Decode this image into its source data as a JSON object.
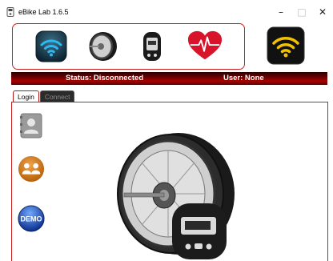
{
  "window": {
    "title": "eBike Lab 1.6.5",
    "controls": {
      "minimize": "–",
      "maximize": "□",
      "close": "✕"
    }
  },
  "toolbar": {
    "buttons": [
      {
        "name": "wifi",
        "icon": "wifi-icon"
      },
      {
        "name": "motor",
        "icon": "motor-icon"
      },
      {
        "name": "display",
        "icon": "display-icon"
      },
      {
        "name": "heart",
        "icon": "heart-rate-icon"
      }
    ],
    "connection_icon": "wifi-connection-icon"
  },
  "status": {
    "status_text": "Status: Disconnected",
    "user_text": "User: None",
    "bar_color": "#8b0000"
  },
  "tabs": [
    {
      "label": "Login",
      "active": true
    },
    {
      "label": "Connect",
      "active": false
    }
  ],
  "login_panel": {
    "side_buttons": [
      {
        "name": "contacts",
        "icon": "contact-book-icon"
      },
      {
        "name": "users",
        "icon": "users-group-icon"
      },
      {
        "name": "demo",
        "icon": "demo-icon",
        "label": "DEMO"
      }
    ],
    "image": "motor-with-display-image"
  },
  "colors": {
    "accent": "#cc1f1f",
    "status_bar": "#8b0000"
  }
}
